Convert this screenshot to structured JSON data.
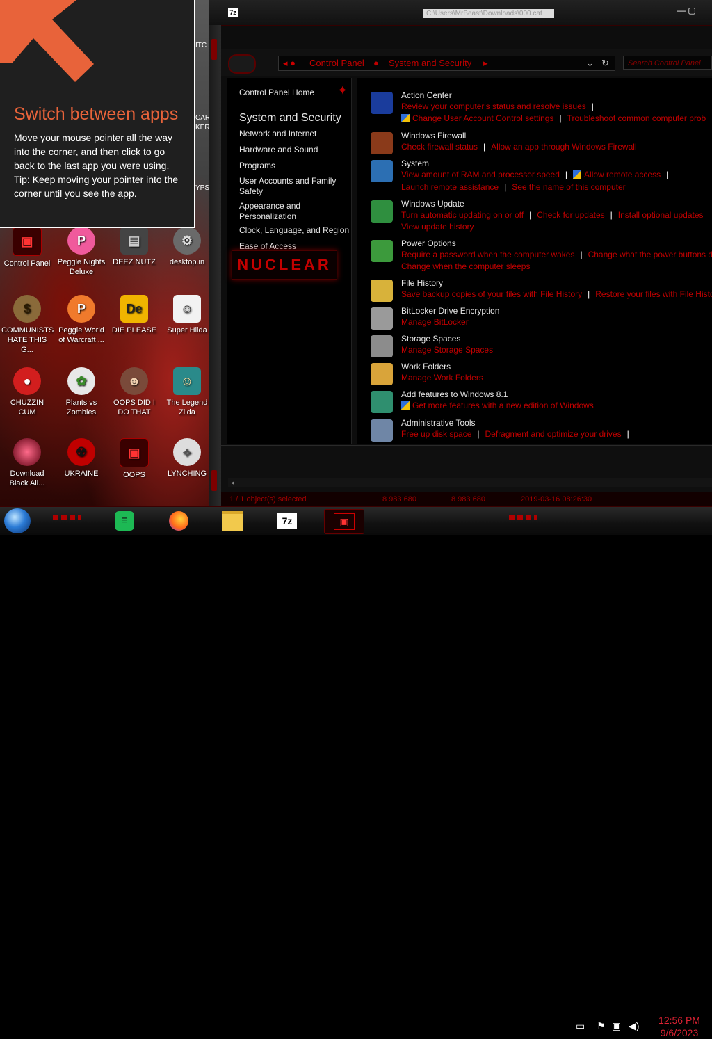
{
  "tip": {
    "title": "Switch between apps",
    "body": "Move your mouse pointer all the way into the corner, and then click to go back to the last app you were using.",
    "tip": "Tip: Keep moving your pointer into the corner until you see the app."
  },
  "desktop_icons": [
    {
      "label": "Control Panel"
    },
    {
      "label": "Peggle Nights Deluxe"
    },
    {
      "label": "DEEZ NUTZ"
    },
    {
      "label": "desktop.in"
    },
    {
      "label": "COMMUNISTS HATE THIS G..."
    },
    {
      "label": "Peggle World of Warcraft ..."
    },
    {
      "label": "DIE PLEASE"
    },
    {
      "label": "Super Hilda"
    },
    {
      "label": "CHUZZIN CUM"
    },
    {
      "label": "Plants vs Zombies"
    },
    {
      "label": "OOPS DID I DO THAT"
    },
    {
      "label": "The Legend Zilda"
    },
    {
      "label": "Download Black Ali..."
    },
    {
      "label": "UKRAINE"
    },
    {
      "label": "OOPS"
    },
    {
      "label": "LYNCHING"
    }
  ],
  "desktop_partial": {
    "top1": "ITC",
    "top2": "CAR",
    "top3": "KER",
    "top4": "YPS"
  },
  "window": {
    "title_path": "C:\\Users\\MrBeast\\Downloads\\000.cat",
    "title_icon": "7z",
    "controls": "— ▢"
  },
  "address": {
    "crumb1": "Control Panel",
    "crumb2": "System and Security",
    "search_placeholder": "Search Control Panel"
  },
  "leftpane": {
    "home": "Control Panel Home",
    "current": "System and Security",
    "items": [
      "Network and Internet",
      "Hardware and Sound",
      "Programs",
      "User Accounts and Family Safety",
      "Appearance and Personalization",
      "Clock, Language, and Region",
      "Ease of Access"
    ],
    "logo": "NUCLEAR"
  },
  "categories": [
    {
      "title": "Action Center",
      "lines": [
        [
          "Review your computer's status and resolve issues"
        ],
        [
          "Change User Account Control settings",
          "Troubleshoot common computer prob"
        ]
      ],
      "color": "#1a3c9c"
    },
    {
      "title": "Windows Firewall",
      "lines": [
        [
          "Check firewall status",
          "Allow an app through Windows Firewall"
        ]
      ],
      "color": "#8a3a1a"
    },
    {
      "title": "System",
      "lines": [
        [
          "View amount of RAM and processor speed",
          "Allow remote access"
        ],
        [
          "Launch remote assistance",
          "See the name of this computer"
        ]
      ],
      "color": "#2c6fb3"
    },
    {
      "title": "Windows Update",
      "lines": [
        [
          "Turn automatic updating on or off",
          "Check for updates",
          "Install optional updates"
        ],
        [
          "View update history"
        ]
      ],
      "color": "#2f8f3f"
    },
    {
      "title": "Power Options",
      "lines": [
        [
          "Require a password when the computer wakes",
          "Change what the power buttons d"
        ],
        [
          "Change when the computer sleeps"
        ]
      ],
      "color": "#3c9a3c"
    },
    {
      "title": "File History",
      "lines": [
        [
          "Save backup copies of your files with File History",
          "Restore your files with File Histo"
        ]
      ],
      "color": "#d8b23a"
    },
    {
      "title": "BitLocker Drive Encryption",
      "lines": [
        [
          "Manage BitLocker"
        ]
      ],
      "color": "#9a9a9a"
    },
    {
      "title": "Storage Spaces",
      "lines": [
        [
          "Manage Storage Spaces"
        ]
      ],
      "color": "#8c8c8c"
    },
    {
      "title": "Work Folders",
      "lines": [
        [
          "Manage Work Folders"
        ]
      ],
      "color": "#d9a43a"
    },
    {
      "title": "Add features to Windows 8.1",
      "lines": [
        [
          "Get more features with a new edition of Windows"
        ]
      ],
      "color": "#2f8f6f"
    },
    {
      "title": "Administrative Tools",
      "lines": [
        [
          "Free up disk space",
          "Defragment and optimize your drives"
        ]
      ],
      "color": "#6f86a6"
    }
  ],
  "status": {
    "selected": "1 / 1 object(s) selected",
    "size1": "8 983 680",
    "size2": "8 983 680",
    "date": "2019-03-16 08:26:30"
  },
  "taskbar": {
    "apps": [
      "Spotify",
      "Firefox",
      "File Explorer",
      "7-Zip",
      "Control Panel"
    ],
    "time": "12:56 PM",
    "date": "9/6/2023"
  }
}
